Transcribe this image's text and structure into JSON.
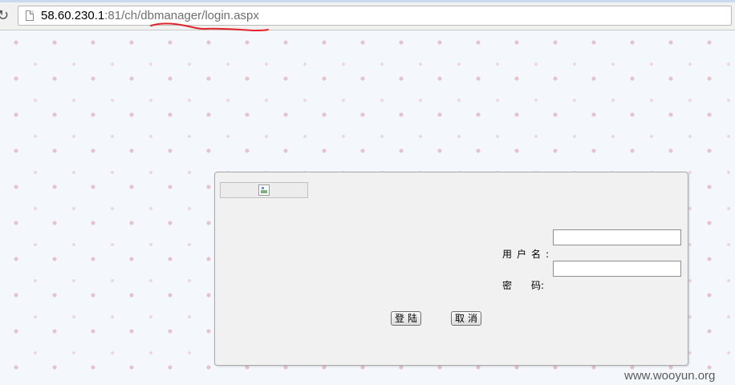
{
  "browser": {
    "url_host": "58.60.230.1",
    "url_rest": ":81/ch/dbmanager/login.aspx",
    "reload_icon": "reload-icon",
    "page_icon": "page-icon"
  },
  "login_form": {
    "username_label": "用户名:",
    "password_label_1": "密",
    "password_label_2": "码:",
    "username_value": "",
    "password_value": "",
    "login_button": "登陆",
    "cancel_button": "取消",
    "logo_icon": "broken-image-icon"
  },
  "watermark": "www.wooyun.org",
  "colors": {
    "annotation_underline": "#e0242a",
    "page_background": "#f4f8fc"
  }
}
